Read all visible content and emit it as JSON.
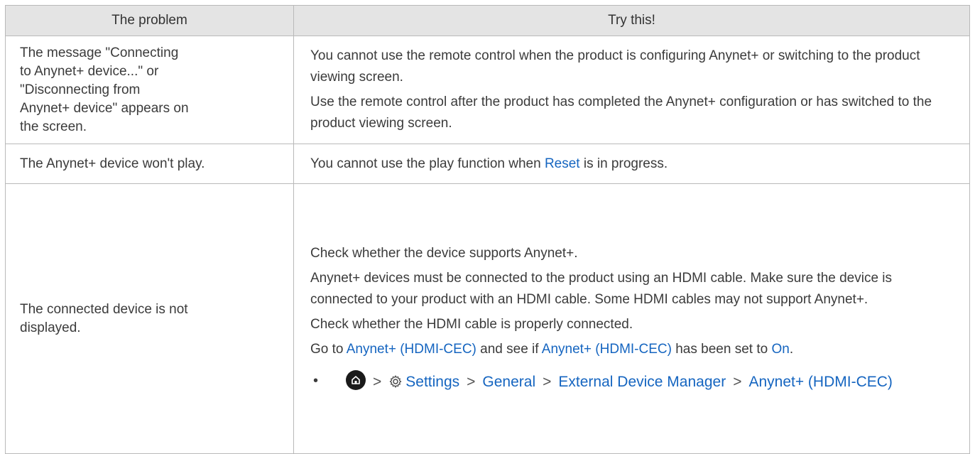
{
  "table": {
    "headers": {
      "problem": "The problem",
      "try": "Try this!"
    },
    "rows": [
      {
        "problem": "The message \"Connecting to Anynet+ device...\" or \"Disconnecting from Anynet+ device\" appears on the screen.",
        "p1": "You cannot use the remote control when the product is configuring Anynet+ or switching to the product viewing screen.",
        "p2": "Use the remote control after the product has completed the Anynet+ configuration or has switched to the product viewing screen."
      },
      {
        "problem": "The Anynet+ device won't play.",
        "p1_before": "You cannot use the play function when ",
        "p1_link": "Reset",
        "p1_after": " is in progress."
      },
      {
        "problem": "The connected device is not displayed.",
        "p1": "Check whether the device supports Anynet+.",
        "p2": "Anynet+ devices must be connected to the product using an HDMI cable. Make sure the device is connected to your product with an HDMI cable. Some HDMI cables may not support Anynet+.",
        "p3": "Check whether the HDMI cable is properly connected.",
        "p4": {
          "t1": "Go to ",
          "l1": "Anynet+ (HDMI-CEC)",
          "t2": " and see if ",
          "l2": "Anynet+ (HDMI-CEC)",
          "t3": " has been set to ",
          "l3": "On",
          "t4": "."
        },
        "bullet": "•",
        "path": {
          "chevron": ">",
          "settings": "Settings",
          "general": "General",
          "external": "External Device Manager",
          "anynet": "Anynet+ (HDMI-CEC)"
        }
      }
    ]
  },
  "colors": {
    "link": "#1565c0",
    "header_bg": "#e4e4e4",
    "border": "#b9b9b9",
    "text": "#3b3b3b"
  },
  "icons": [
    "home-icon",
    "settings-gear-icon"
  ]
}
